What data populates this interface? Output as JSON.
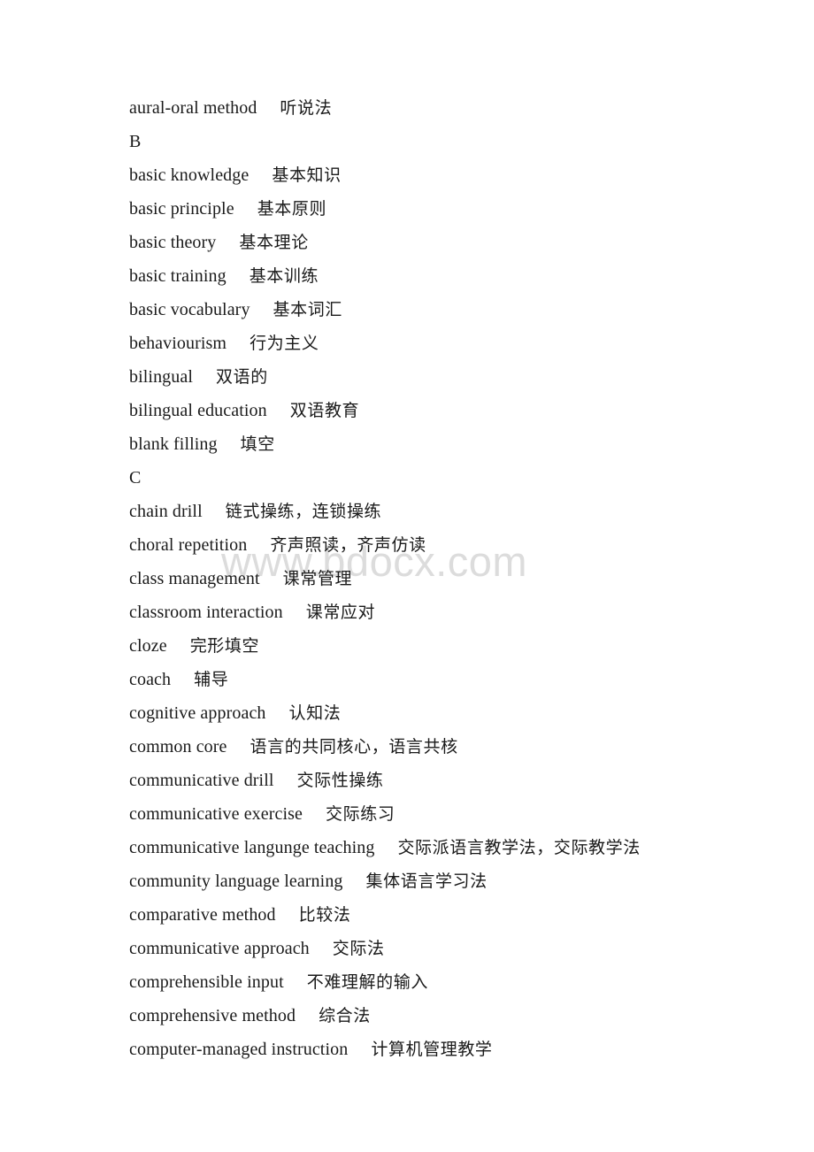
{
  "document": {
    "type": "glossary",
    "page_background": "#ffffff",
    "text_color": "#1a1a1a",
    "watermark": {
      "text": "www.bdocx.com",
      "color": "#dcdcdc"
    },
    "entries": [
      {
        "term": "aural-oral method",
        "gloss": "听说法",
        "is_heading": false
      },
      {
        "term": "B",
        "gloss": "",
        "is_heading": true
      },
      {
        "term": "basic knowledge",
        "gloss": "基本知识",
        "is_heading": false
      },
      {
        "term": "basic principle",
        "gloss": "基本原则",
        "is_heading": false
      },
      {
        "term": "basic theory",
        "gloss": "基本理论",
        "is_heading": false
      },
      {
        "term": "basic training",
        "gloss": "基本训练",
        "is_heading": false
      },
      {
        "term": "basic vocabulary",
        "gloss": "基本词汇",
        "is_heading": false
      },
      {
        "term": "behaviourism",
        "gloss": "行为主义",
        "is_heading": false
      },
      {
        "term": "bilingual",
        "gloss": "双语的",
        "is_heading": false
      },
      {
        "term": "bilingual education",
        "gloss": "双语教育",
        "is_heading": false
      },
      {
        "term": "blank filling",
        "gloss": "填空",
        "is_heading": false
      },
      {
        "term": "C",
        "gloss": "",
        "is_heading": true
      },
      {
        "term": "chain drill",
        "gloss": "链式操练，连锁操练",
        "is_heading": false
      },
      {
        "term": "choral repetition",
        "gloss": "齐声照读，齐声仿读",
        "is_heading": false
      },
      {
        "term": "class management",
        "gloss": "课常管理",
        "is_heading": false
      },
      {
        "term": "classroom interaction",
        "gloss": "课常应对",
        "is_heading": false
      },
      {
        "term": "cloze",
        "gloss": "完形填空",
        "is_heading": false
      },
      {
        "term": "coach",
        "gloss": "辅导",
        "is_heading": false
      },
      {
        "term": "cognitive approach",
        "gloss": "认知法",
        "is_heading": false
      },
      {
        "term": "common core",
        "gloss": "语言的共同核心，语言共核",
        "is_heading": false
      },
      {
        "term": "communicative drill",
        "gloss": "交际性操练",
        "is_heading": false
      },
      {
        "term": "communicative exercise",
        "gloss": "交际练习",
        "is_heading": false
      },
      {
        "term": "communicative langunge teaching",
        "gloss": "交际派语言教学法，交际教学法",
        "is_heading": false
      },
      {
        "term": "community language learning",
        "gloss": "集体语言学习法",
        "is_heading": false
      },
      {
        "term": "comparative method",
        "gloss": "比较法",
        "is_heading": false
      },
      {
        "term": "communicative approach",
        "gloss": "交际法",
        "is_heading": false
      },
      {
        "term": "comprehensible input",
        "gloss": "不难理解的输入",
        "is_heading": false
      },
      {
        "term": "comprehensive method",
        "gloss": "综合法",
        "is_heading": false
      },
      {
        "term": "computer-managed instruction",
        "gloss": "计算机管理教学",
        "is_heading": false
      }
    ]
  }
}
